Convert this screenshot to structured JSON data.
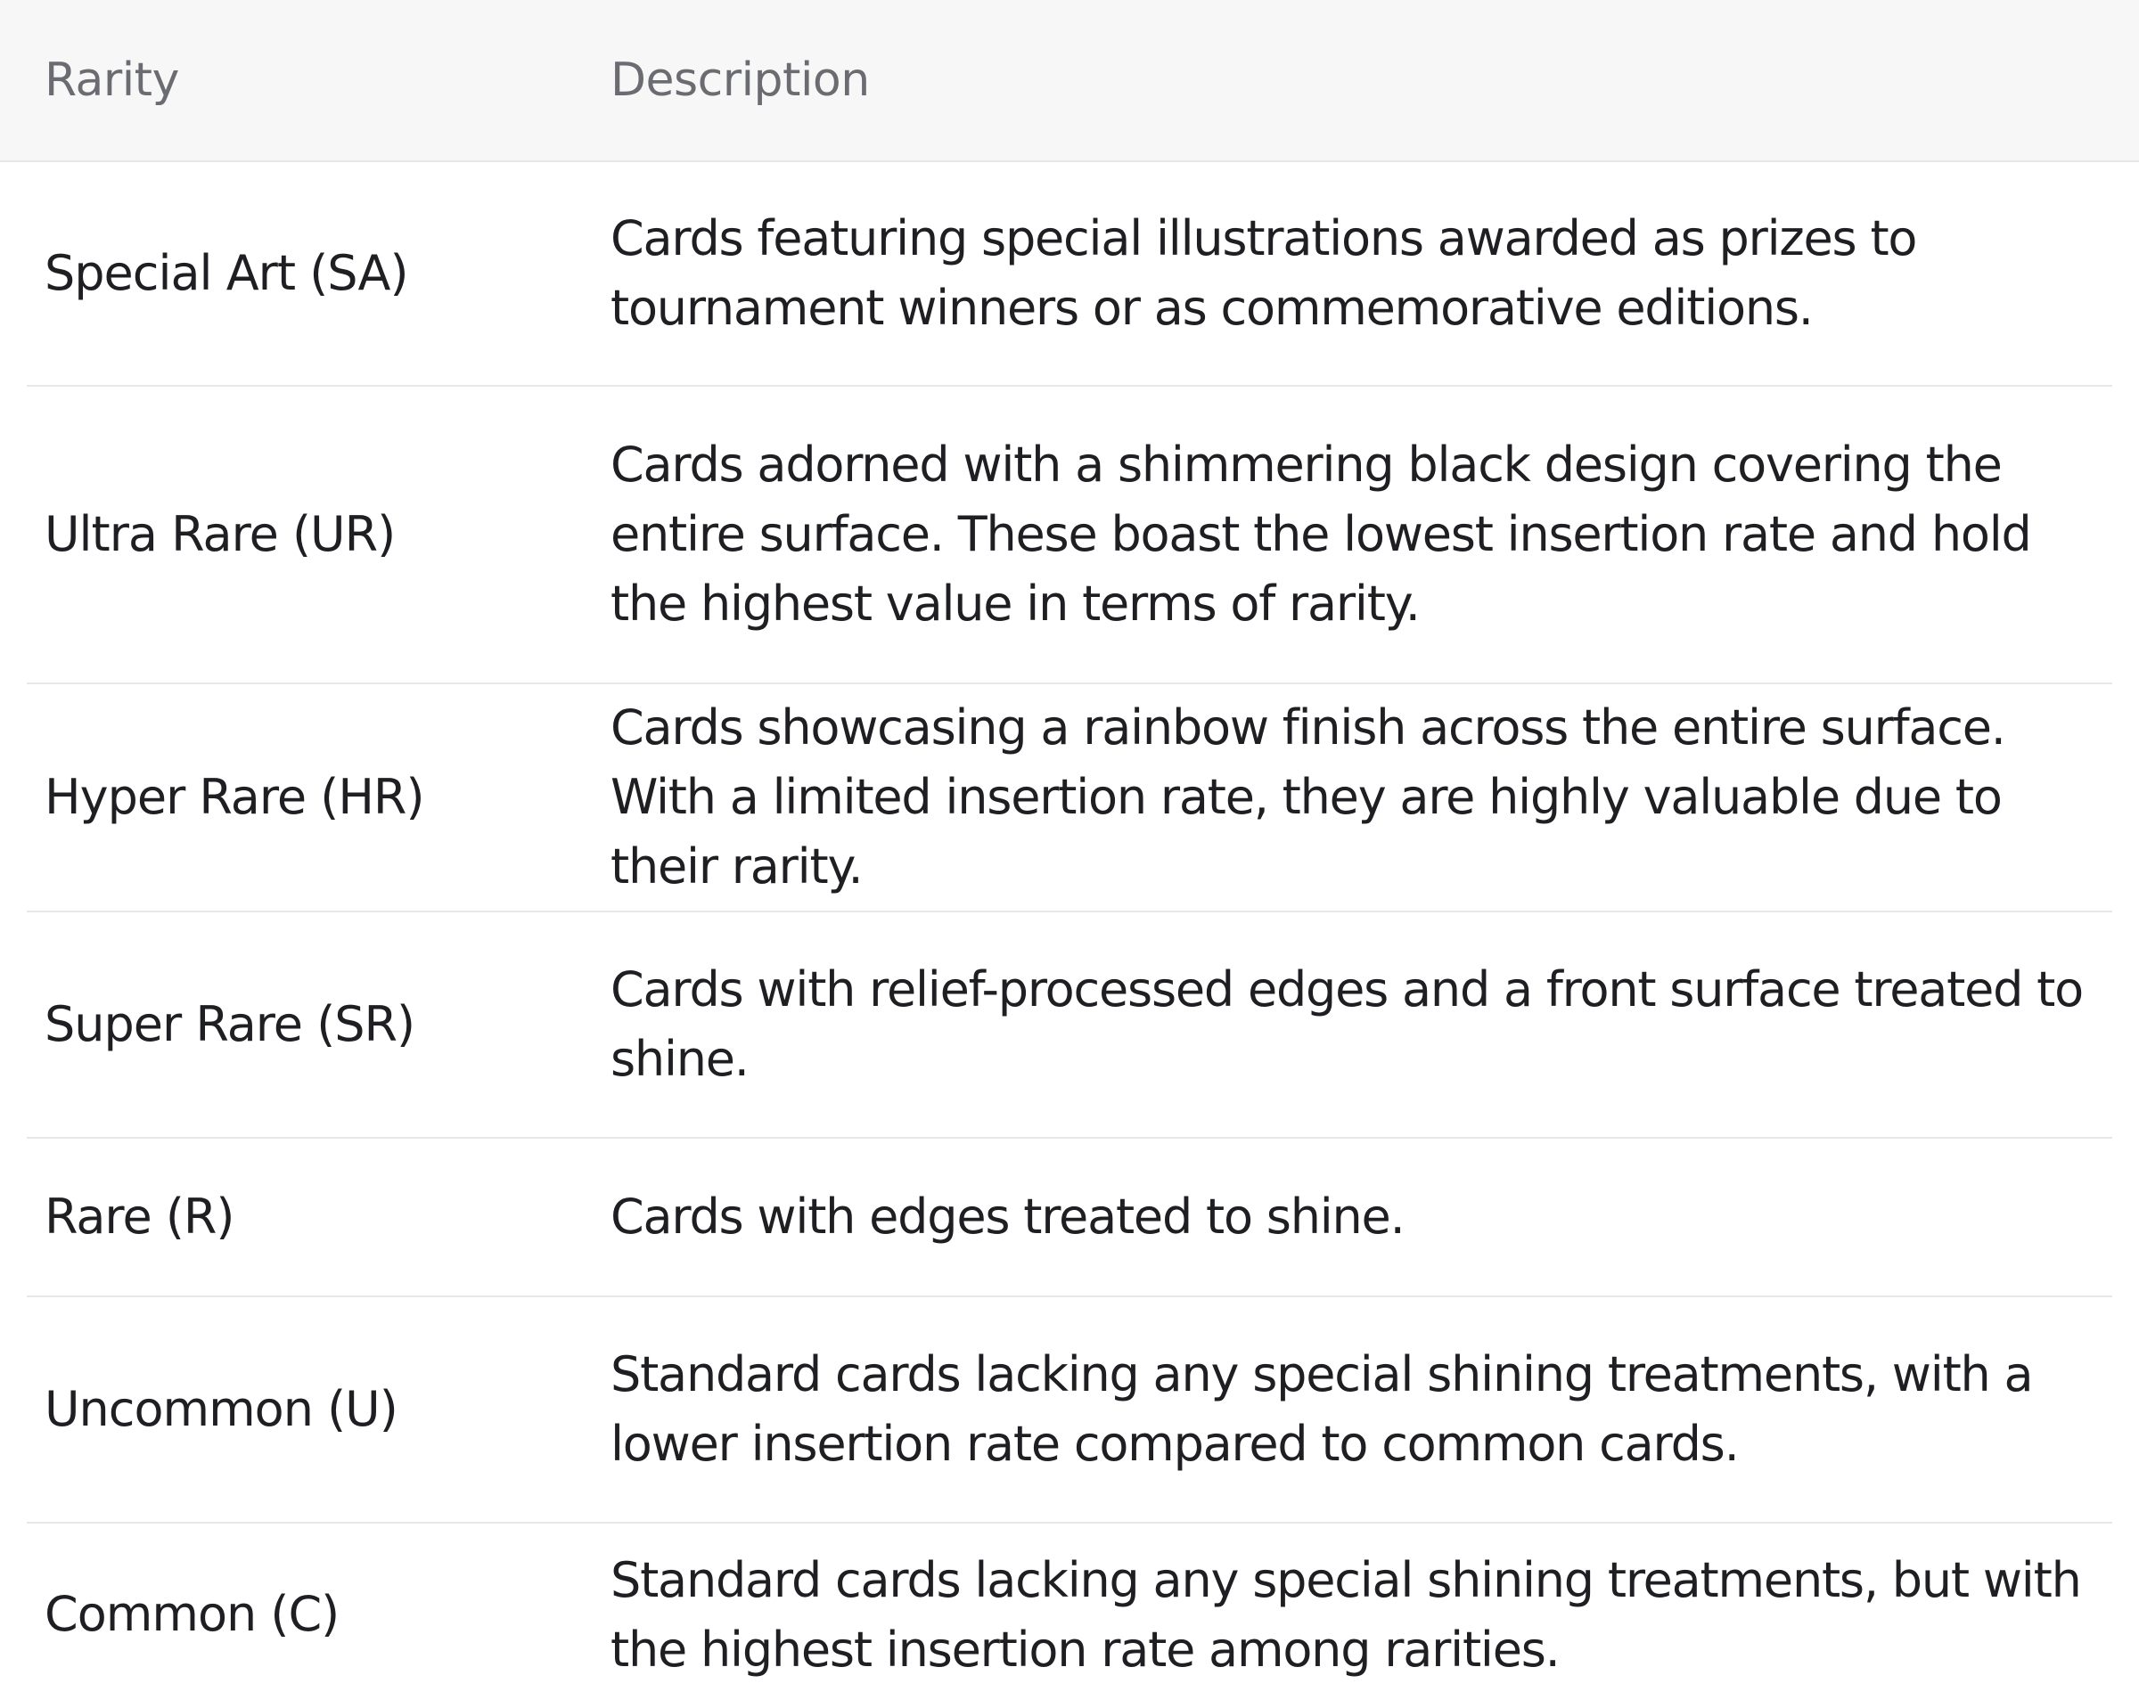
{
  "table": {
    "headers": {
      "rarity": "Rarity",
      "description": "Description"
    },
    "rows": [
      {
        "rarity": "Special Art (SA)",
        "description": "Cards featuring special illustrations awarded as prizes to tournament winners or as commemorative editions."
      },
      {
        "rarity": "Ultra Rare (UR)",
        "description": "Cards adorned with a shimmering black design covering the entire surface. These boast the lowest insertion rate and hold the highest value in terms of rarity."
      },
      {
        "rarity": "Hyper Rare (HR)",
        "description": "Cards showcasing a rainbow finish across the entire surface. With a limited insertion rate, they are highly valuable due to their rarity."
      },
      {
        "rarity": "Super Rare (SR)",
        "description": "Cards with relief-processed edges and a front surface treated to shine."
      },
      {
        "rarity": "Rare (R)",
        "description": "Cards with edges treated to shine."
      },
      {
        "rarity": "Uncommon (U)",
        "description": "Standard cards lacking any special shining treatments, with a lower insertion rate compared to common cards."
      },
      {
        "rarity": "Common (C)",
        "description": "Standard cards lacking any special shining treatments, but with the highest insertion rate among rarities."
      }
    ]
  }
}
